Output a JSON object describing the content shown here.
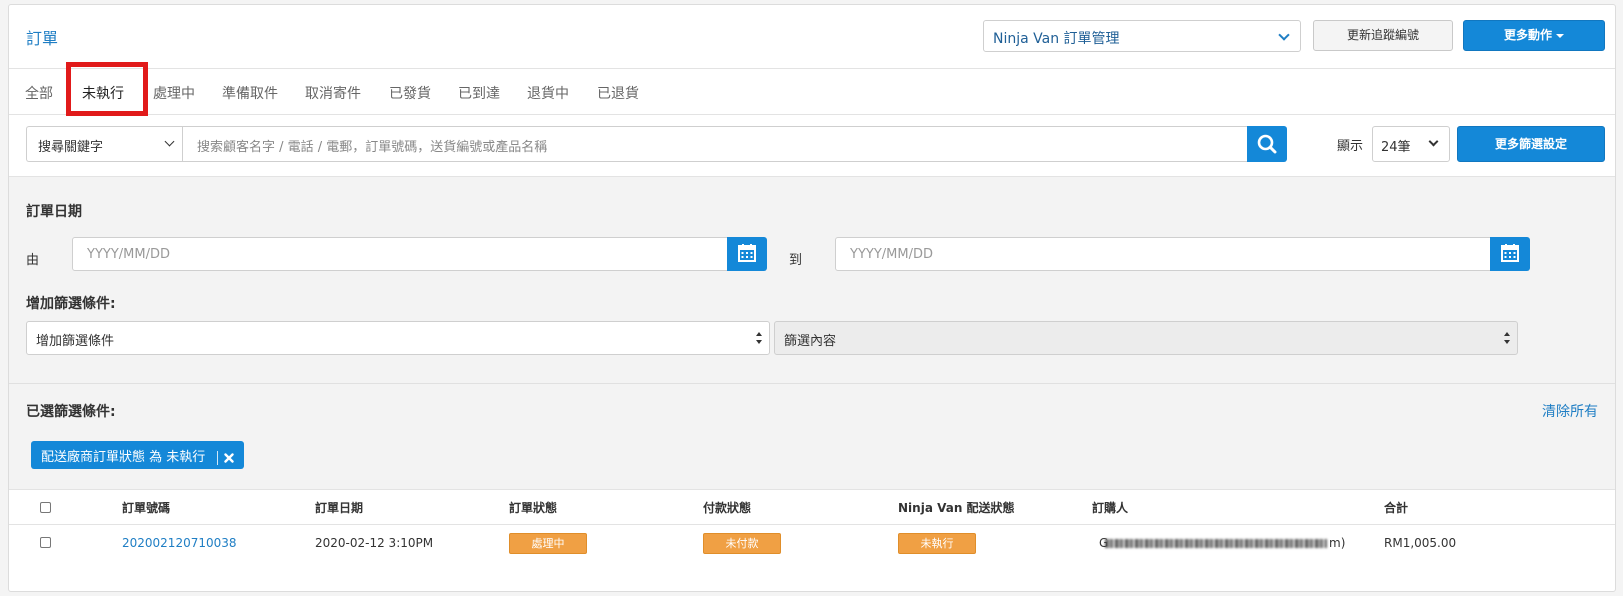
{
  "header": {
    "title": "訂單",
    "channel_select": "Ninja Van 訂單管理",
    "update_tracking_label": "更新追蹤編號",
    "more_actions_label": "更多動作"
  },
  "tabs": [
    {
      "label": "全部"
    },
    {
      "label": "未執行",
      "active": true
    },
    {
      "label": "處理中"
    },
    {
      "label": "準備取件"
    },
    {
      "label": "取消寄件"
    },
    {
      "label": "已發貨"
    },
    {
      "label": "已到達"
    },
    {
      "label": "退貨中"
    },
    {
      "label": "已退貨"
    }
  ],
  "search": {
    "keyword_select": "搜尋關鍵字",
    "placeholder": "搜索顧客名字 / 電話 / 電郵，訂單號碼，送貨編號或產品名稱",
    "show_label": "顯示",
    "per_page": "24筆",
    "more_filters_label": "更多篩選設定"
  },
  "filters": {
    "order_date_title": "訂單日期",
    "from_label": "由",
    "to_label": "到",
    "date_placeholder": "YYYY/MM/DD",
    "add_filter_title": "增加篩選條件:",
    "add_filter_select": "增加篩選條件",
    "filter_content_select": "篩選內容",
    "selected_title": "已選篩選條件:",
    "clear_all": "清除所有",
    "chips": [
      {
        "label": "配送廠商訂單狀態 為 未執行"
      }
    ]
  },
  "table": {
    "headers": [
      "訂單號碼",
      "訂單日期",
      "訂單狀態",
      "付款狀態",
      "Ninja Van 配送狀態",
      "訂購人",
      "合計"
    ],
    "rows": [
      {
        "order_no": "202002120710038",
        "date": "2020-02-12 3:10PM",
        "order_status": "處理中",
        "payment_status": "未付款",
        "delivery_status": "未執行",
        "customer_prefix": "G",
        "customer_suffix": "m)",
        "total": "RM1,005.00"
      }
    ]
  },
  "colors": {
    "accent": "#1488d8",
    "link": "#1f7ec4",
    "badge": "#f0a044",
    "highlight": "#e11a1a"
  }
}
